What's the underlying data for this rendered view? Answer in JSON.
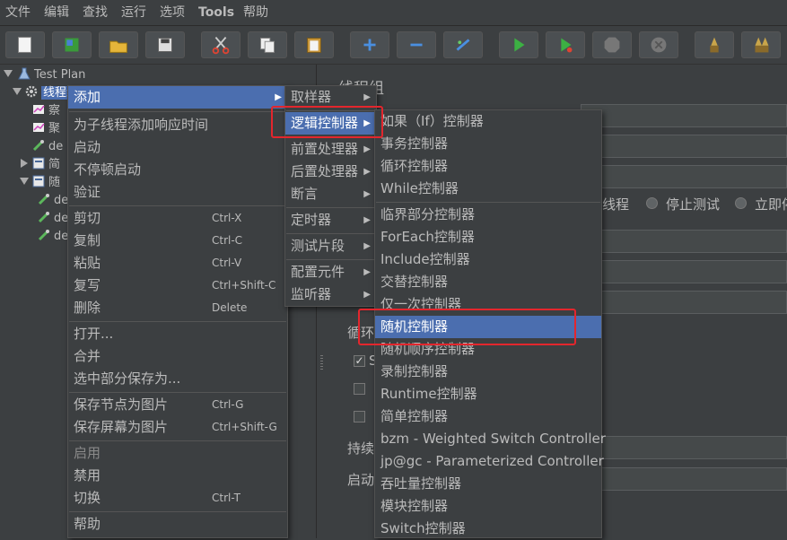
{
  "menubar": {
    "items": [
      "文件",
      "编辑",
      "查找",
      "运行",
      "选项",
      "Tools",
      "帮助"
    ]
  },
  "toolbar": {
    "buttons": [
      "new-icon",
      "templates-icon",
      "open-icon",
      "save-icon",
      "cut-icon",
      "copy-icon",
      "paste-icon",
      "expand-icon",
      "collapse-icon",
      "toggle-icon",
      "start-icon",
      "start-no-pause-icon",
      "stop-icon",
      "shutdown-icon",
      "clear-icon",
      "clear-all-icon"
    ]
  },
  "tree": {
    "root": "Test Plan",
    "thread_group": "线程组",
    "children": [
      "察",
      "聚",
      "de",
      "简",
      "随",
      "de",
      "de",
      "de"
    ]
  },
  "editor": {
    "title": "线程组",
    "radio_thread": "线程",
    "radio_stop_test": "停止测试",
    "radio_stop_now": "立即停",
    "loop_label": "循环",
    "checkbox_s": "S",
    "checkbox_mark": "✓",
    "persist_label": "持续",
    "startup_label": "启动"
  },
  "menu_main": {
    "add": "添加",
    "add_think_time": "为子线程添加响应时间",
    "start": "启动",
    "start_no_pause": "不停顿启动",
    "validate": "验证",
    "cut": "剪切",
    "cut_sc": "Ctrl-X",
    "copy": "复制",
    "copy_sc": "Ctrl-C",
    "paste": "粘贴",
    "paste_sc": "Ctrl-V",
    "duplicate": "复写",
    "duplicate_sc": "Ctrl+Shift-C",
    "remove": "删除",
    "remove_sc": "Delete",
    "open": "打开...",
    "merge": "合并",
    "save_selection": "选中部分保存为...",
    "save_node_image": "保存节点为图片",
    "save_node_image_sc": "Ctrl-G",
    "save_screen_image": "保存屏幕为图片",
    "save_screen_image_sc": "Ctrl+Shift-G",
    "enable": "启用",
    "disable": "禁用",
    "toggle": "切换",
    "toggle_sc": "Ctrl-T",
    "help": "帮助"
  },
  "menu_add": {
    "sampler": "取样器",
    "logic_controller": "逻辑控制器",
    "pre_processor": "前置处理器",
    "post_processor": "后置处理器",
    "assertion": "断言",
    "timer": "定时器",
    "test_fragment": "测试片段",
    "config_element": "配置元件",
    "listener": "监听器"
  },
  "menu_logic": {
    "if": "如果（If）控制器",
    "transaction": "事务控制器",
    "loop": "循环控制器",
    "while": "While控制器",
    "critical_section": "临界部分控制器",
    "foreach": "ForEach控制器",
    "include": "Include控制器",
    "interleave": "交替控制器",
    "once_only": "仅一次控制器",
    "random": "随机控制器",
    "random_order": "随机顺序控制器",
    "recording": "录制控制器",
    "runtime": "Runtime控制器",
    "simple": "简单控制器",
    "bzm_weighted": "bzm - Weighted Switch Controller",
    "jpgc_parameterized": "jp@gc - Parameterized Controller",
    "throughput": "吞吐量控制器",
    "module": "模块控制器",
    "switch": "Switch控制器"
  },
  "colors": {
    "background": "#3c3f41",
    "selection": "#4b6eaf",
    "highlight_box": "#e3262d",
    "text": "#bbbbbb"
  }
}
